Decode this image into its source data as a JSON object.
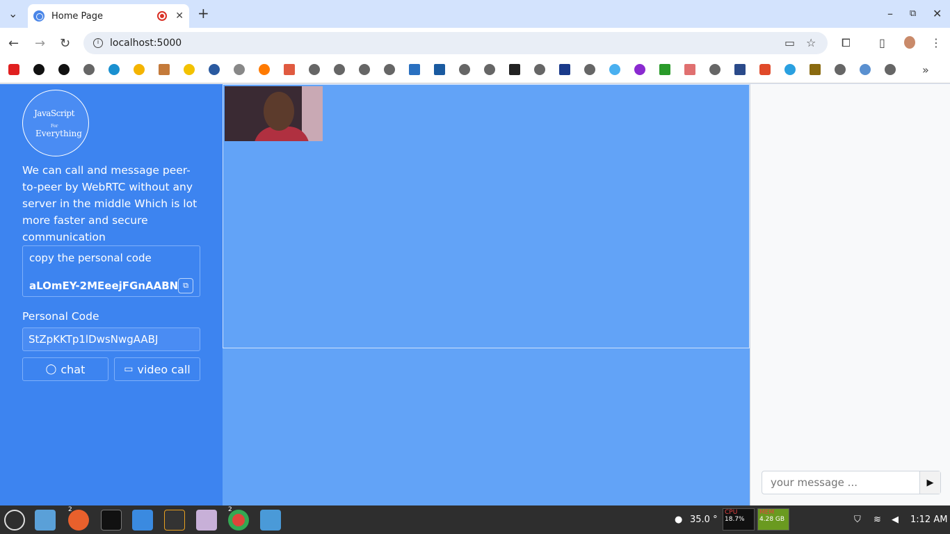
{
  "browser": {
    "tab_title": "Home Page",
    "url": "localhost:5000"
  },
  "sidebar": {
    "logo_line1": "JavaScript",
    "logo_line2": "For",
    "logo_line3": "Everything",
    "description": "We can call and message peer-to-peer by WebRTC without any server in the middle Which is lot more faster and secure communication",
    "copy_label": "copy the personal code",
    "my_code": "aLOmEY-2MEeejFGnAABN",
    "personal_code_label": "Personal Code",
    "personal_code_value": "StZpKKTp1lDwsNwgAABJ",
    "chat_label": "chat",
    "video_call_label": "video call"
  },
  "chat": {
    "placeholder": "your message ..."
  },
  "taskbar": {
    "firefox_badge": "2",
    "chrome_badge": "2",
    "temperature": "35.0 °",
    "cpu_label": "CPU",
    "cpu_value": "18.7%",
    "mem_label": "MEM",
    "mem_value": "4.28 GB",
    "time": "1:12 AM"
  },
  "colors": {
    "sidebar_bg": "#3d84f0",
    "video_bg": "#62a3f7",
    "chat_bg": "#f8f9fa"
  }
}
